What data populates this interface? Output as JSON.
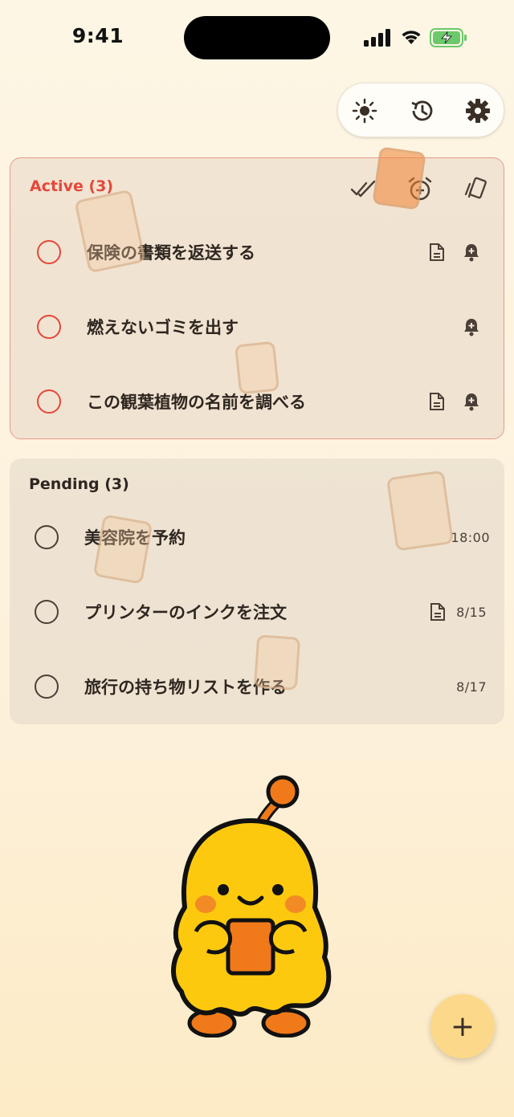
{
  "status": {
    "time": "9:41"
  },
  "toolbar": {
    "icons": [
      "brightness-icon",
      "history-icon",
      "settings-icon"
    ]
  },
  "active": {
    "title": "Active (3)",
    "header_icons": [
      "mark-all-done-icon",
      "add-alarm-icon",
      "cards-icon"
    ],
    "tasks": [
      {
        "text": "保険の書類を返送する",
        "has_note": true,
        "has_reminder": true
      },
      {
        "text": "燃えないゴミを出す",
        "has_note": false,
        "has_reminder": true
      },
      {
        "text": "この観葉植物の名前を調べる",
        "has_note": true,
        "has_reminder": true
      }
    ]
  },
  "pending": {
    "title": "Pending (3)",
    "tasks": [
      {
        "text": "美容院を予約",
        "meta": "18:00",
        "has_note": false
      },
      {
        "text": "プリンターのインクを注文",
        "meta": "8/15",
        "has_note": true
      },
      {
        "text": "旅行の持ち物リストを作る",
        "meta": "8/17",
        "has_note": false
      }
    ]
  },
  "fab": {
    "label": "+"
  },
  "colors": {
    "accent_red": "#e5473b",
    "fab": "#fcd98a",
    "background": "#fdf6e4"
  }
}
